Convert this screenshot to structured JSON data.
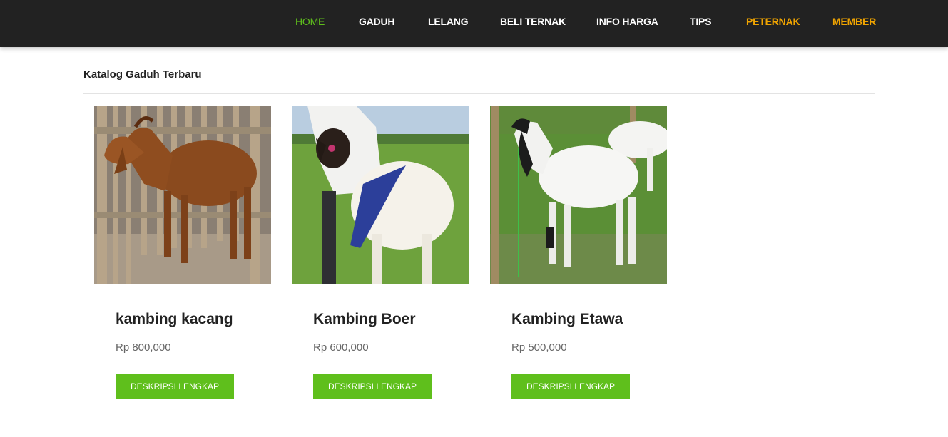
{
  "nav": {
    "items": [
      {
        "label": "HOME"
      },
      {
        "label": "GADUH"
      },
      {
        "label": "LELANG"
      },
      {
        "label": "BELI TERNAK"
      },
      {
        "label": "INFO HARGA"
      },
      {
        "label": "TIPS"
      },
      {
        "label": "PETERNAK"
      },
      {
        "label": "MEMBER"
      }
    ],
    "active_color": "#5fbf1c",
    "accent_color": "#f0a400",
    "bar_color": "#222222"
  },
  "section": {
    "title": "Katalog Gaduh Terbaru"
  },
  "products": [
    {
      "name": "kambing kacang",
      "price": "Rp 800,000",
      "button": "DESKRIPSI LENGKAP",
      "image": "brown-goat-photo"
    },
    {
      "name": "Kambing Boer",
      "price": "Rp 600,000",
      "button": "DESKRIPSI LENGKAP",
      "image": "boer-goat-photo"
    },
    {
      "name": "Kambing Etawa",
      "price": "Rp 500,000",
      "button": "DESKRIPSI LENGKAP",
      "image": "etawa-goat-photo"
    }
  ],
  "button_color": "#5fbf1c"
}
